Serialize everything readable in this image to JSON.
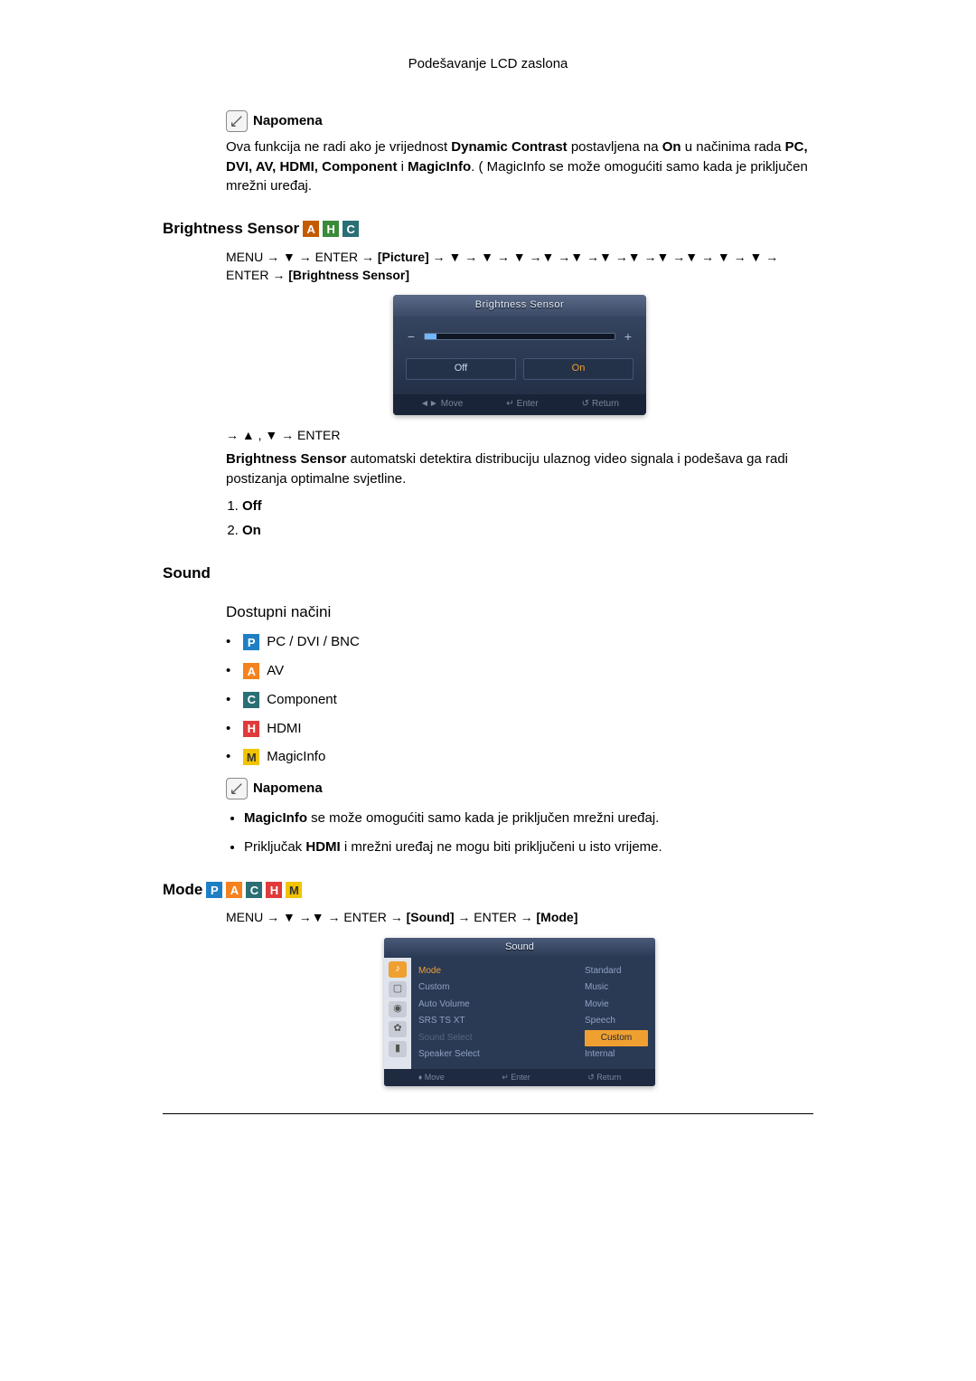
{
  "header": {
    "title": "Podešavanje LCD zaslona"
  },
  "note_label": "Napomena",
  "para1": {
    "pre": "Ova funkcija ne radi ako je vrijednost ",
    "dc": "Dynamic Contrast",
    "mid1": " postavljena na ",
    "on": "On",
    "mid2": " u načinima rada ",
    "list": "PC, DVI, AV, HDMI, Component",
    "and": " i ",
    "mi": "MagicInfo",
    "tail": ". ( MagicInfo se može omogućiti samo kada je priključen mrežni uređaj."
  },
  "bs": {
    "title": "Brightness Sensor",
    "path_pre": "MENU → ▼ → ENTER → ",
    "path_picture": "[Picture]",
    "path_mid": " → ▼ → ▼ → ▼ →▼ →▼ →▼ →▼ →▼ →▼ → ▼ → ▼ → ENTER → ",
    "path_bs": "[Brightness Sensor]",
    "osd_title": "Brightness Sensor",
    "osd_off": "Off",
    "osd_on": "On",
    "osd_move": "Move",
    "osd_enter": "Enter",
    "osd_return": "Return",
    "after": "→ ▲ , ▼ → ENTER",
    "desc_lead": "Brightness Sensor",
    "desc_rest": "  automatski detektira distribuciju ulaznog video signala i podešava ga radi postizanja optimalne svjetline.",
    "opt1": "Off",
    "opt2": "On"
  },
  "sound": {
    "title": "Sound",
    "sub": "Dostupni načini",
    "modes": {
      "p": "PC / DVI / BNC",
      "a": "AV",
      "c": "Component",
      "h": "HDMI",
      "m": "MagicInfo"
    },
    "note_label": "Napomena",
    "n1_lead": "MagicInfo",
    "n1_rest": " se može omogućiti samo kada je priključen mrežni uređaj.",
    "n2_pre": "Priključak ",
    "n2_hdmi": "HDMI",
    "n2_rest": " i mrežni uređaj ne mogu biti priključeni u isto vrijeme."
  },
  "mode": {
    "title": "Mode",
    "path_pre": "MENU → ▼ →▼ → ENTER → ",
    "path_sound": "[Sound]",
    "path_mid": " → ENTER → ",
    "path_mode": "[Mode]",
    "osd_title": "Sound",
    "left_items": [
      "Mode",
      "Custom",
      "Auto Volume",
      "SRS TS XT",
      "Sound Select",
      "Speaker Select"
    ],
    "right_items": [
      "Standard",
      "Music",
      "Movie",
      "Speech",
      "Custom",
      "Internal"
    ],
    "osd_move": "Move",
    "osd_enter": "Enter",
    "osd_return": "Return"
  }
}
